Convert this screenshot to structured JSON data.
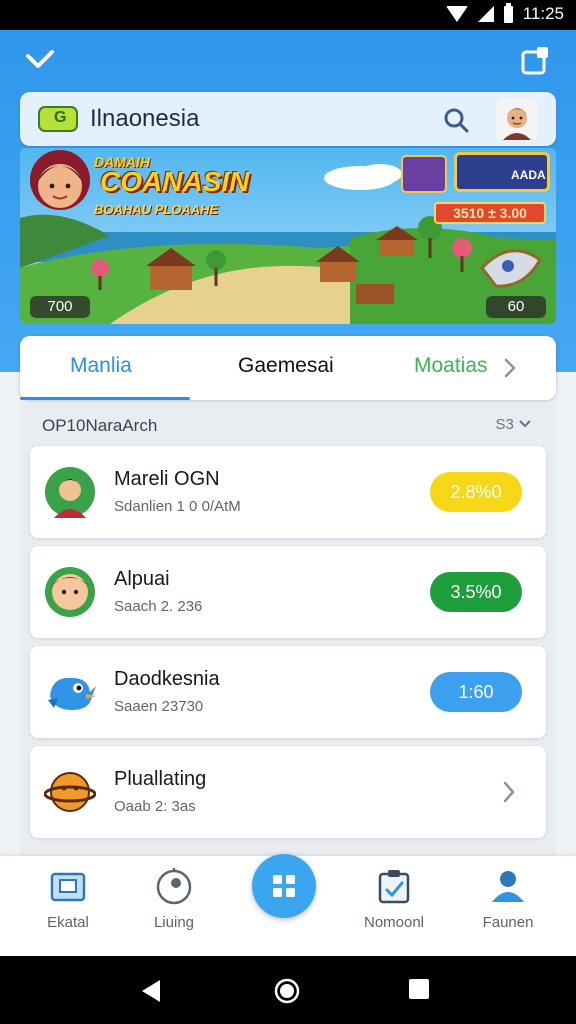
{
  "status_bar": {
    "time": "11:25"
  },
  "header": {
    "search_title": "Ilnaonesia"
  },
  "banner": {
    "sub": "DAMAIH",
    "title": "COANASIN",
    "tag": "BOAHAU PLOAAHE",
    "hud_chip": "AADA",
    "score": "3510 ± 3.00",
    "left_counter": "700",
    "right_counter": "60"
  },
  "tabs": [
    {
      "label": "Manlia"
    },
    {
      "label": "Gaemesai"
    },
    {
      "label": "Moatias"
    }
  ],
  "section": {
    "label": "OP10NaraArch",
    "sort": "S3"
  },
  "rows": [
    {
      "name": "Mareli OGN",
      "sub": "Sdanlien 1 0 0/AtM",
      "badge": "2.8%0"
    },
    {
      "name": "Alpuai",
      "sub": "Saach 2. 236",
      "badge": "3.5%0"
    },
    {
      "name": "Daodkesnia",
      "sub": "Saaen 23730",
      "badge": "1:60"
    },
    {
      "name": "Pluallating",
      "sub": "Oaab 2: 3as",
      "badge": ""
    }
  ],
  "bottom_nav": [
    {
      "label": "Ekatal",
      "icon": "box-icon"
    },
    {
      "label": "Liuing",
      "icon": "timer-icon"
    },
    {
      "label": "",
      "icon": "grid-icon"
    },
    {
      "label": "Nomoonl",
      "icon": "clipboard-icon"
    },
    {
      "label": "Faunen",
      "icon": "person-icon"
    }
  ],
  "colors": {
    "primary": "#2f97ec",
    "accent_green": "#1e9e3a",
    "accent_yellow": "#f7d819"
  }
}
